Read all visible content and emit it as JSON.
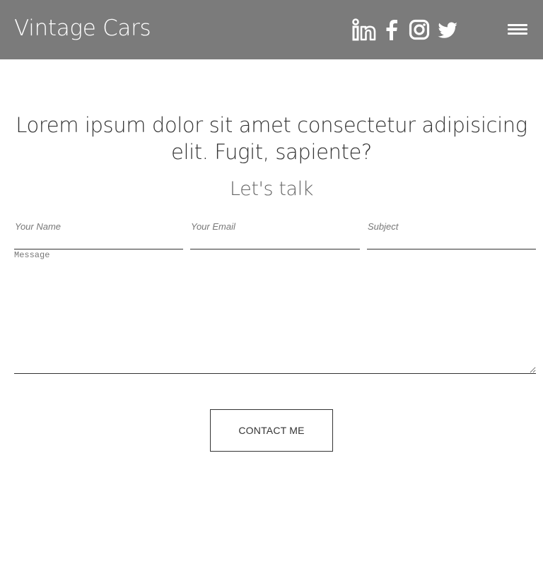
{
  "header": {
    "brand": "Vintage Cars",
    "social_icons": [
      "linkedin-icon",
      "facebook-icon",
      "instagram-icon",
      "twitter-icon"
    ],
    "menu_icon": "hamburger-menu-icon",
    "background": "#7b7b7b"
  },
  "hero": {
    "headline": "Lorem ipsum dolor sit amet consectetur adipisicing elit. Fugit, sapiente?",
    "subheading": "Let's talk"
  },
  "form": {
    "name_placeholder": "Your Name",
    "email_placeholder": "Your Email",
    "subject_placeholder": "Subject",
    "message_placeholder": "Message",
    "submit_label": "CONTACT ME"
  }
}
